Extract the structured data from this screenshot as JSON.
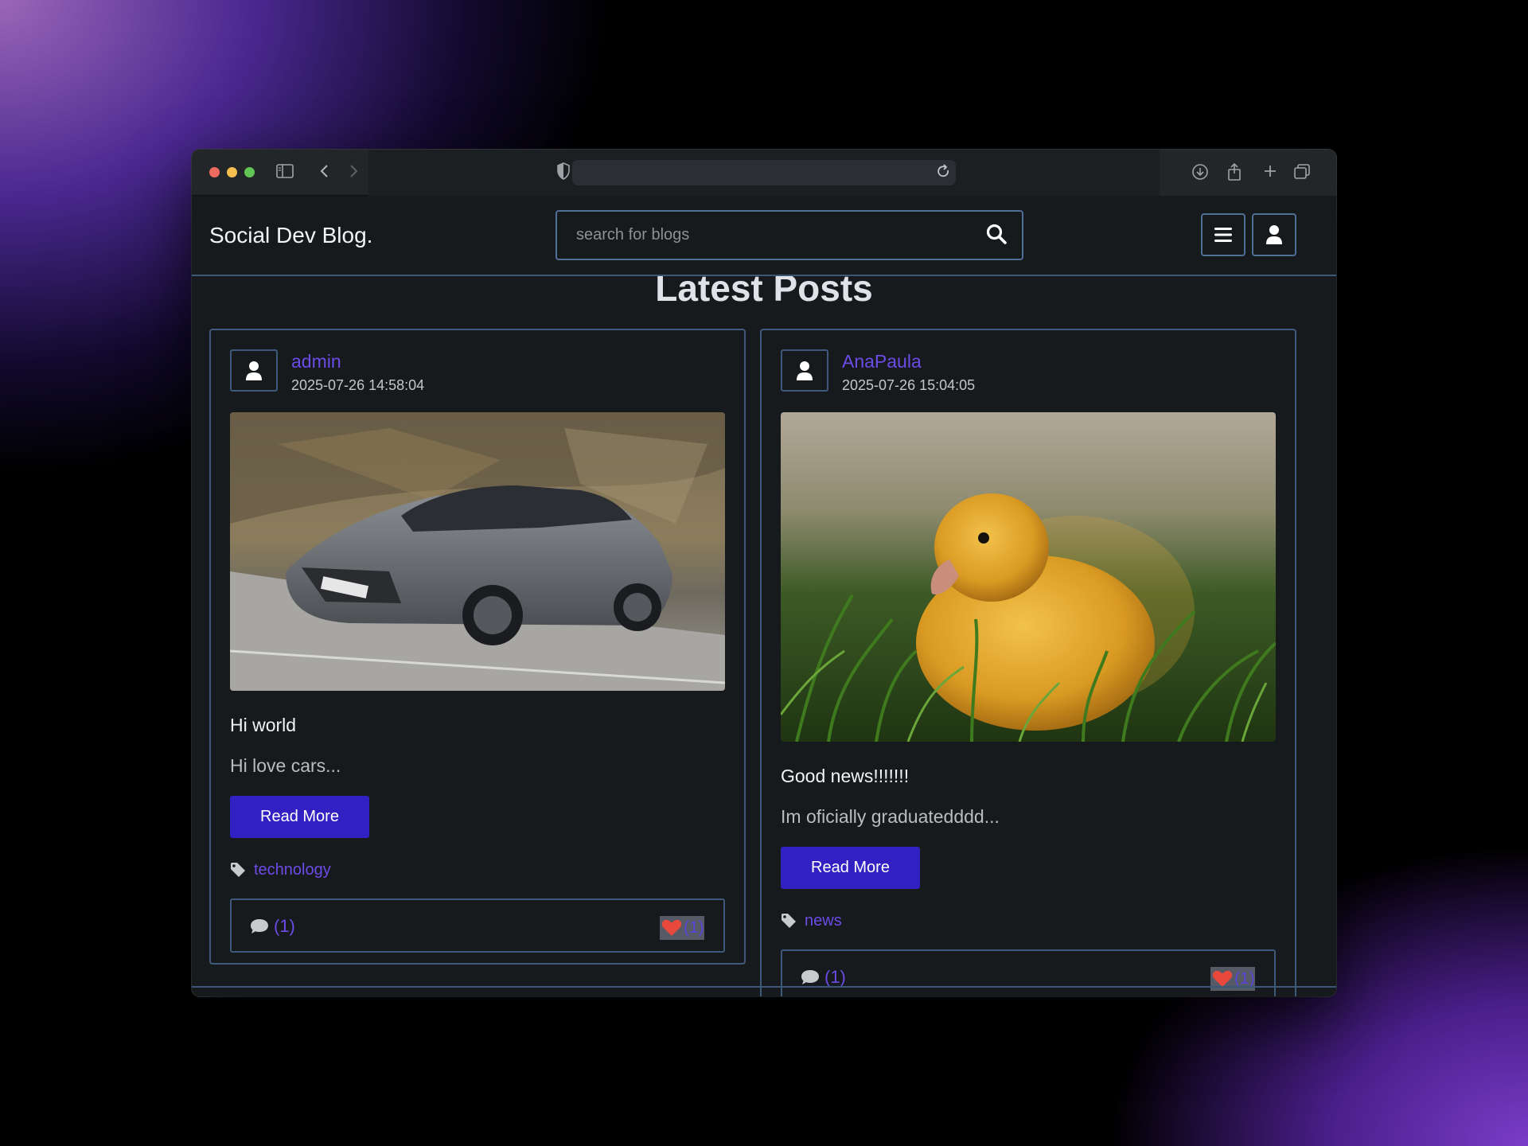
{
  "site": {
    "brand": "Social Dev Blog.",
    "search_placeholder": "search for blogs",
    "page_title": "Latest Posts"
  },
  "icons": {
    "search": "search-icon",
    "menu": "hamburger-icon",
    "user": "user-icon",
    "comment": "comment-icon",
    "like": "heart-icon",
    "tag": "tag-icon"
  },
  "colors": {
    "accent": "#6d4be6",
    "button": "#3121c2",
    "border": "#3d5a7c",
    "heart": "#e8493c"
  },
  "posts": [
    {
      "author": "admin",
      "date": "2025-07-26 14:58:04",
      "image": "grey sedan driving on road",
      "title": "Hi world",
      "excerpt": "Hi love cars...",
      "read_more": "Read More",
      "tag": "technology",
      "comments": "(1)",
      "likes": "(1)"
    },
    {
      "author": "AnaPaula",
      "date": "2025-07-26 15:04:05",
      "image": "yellow duckling in grass",
      "title": "Good news!!!!!!!",
      "excerpt": "Im oficially graduatedddd...",
      "read_more": "Read More",
      "tag": "news",
      "comments": "(1)",
      "likes": "(1)"
    }
  ]
}
